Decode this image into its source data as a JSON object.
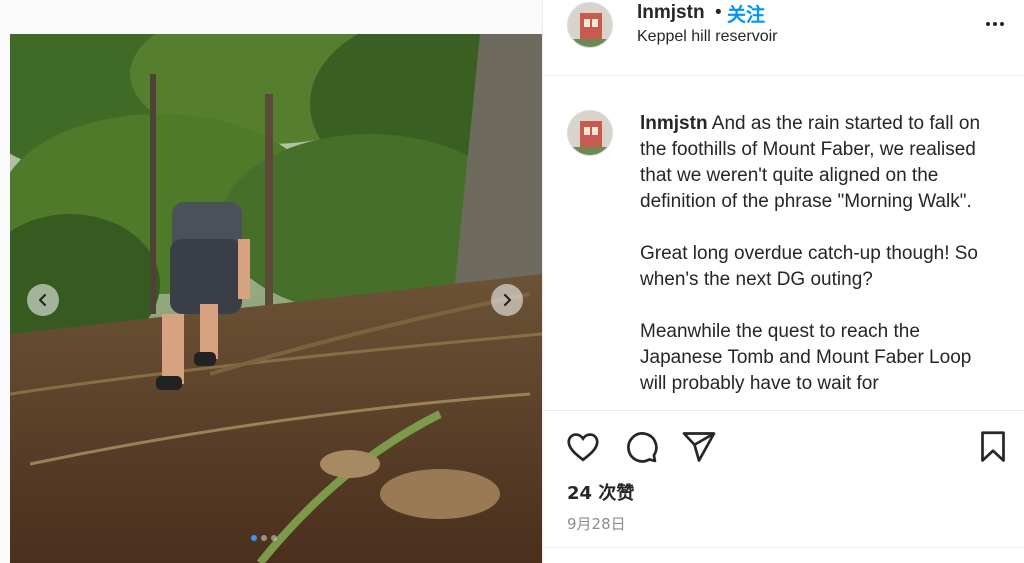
{
  "post": {
    "username": "lnmjstn",
    "separator": "•",
    "follow_label": "关注",
    "location": "Keppel hill reservoir",
    "more_icon": "more-horizontal-icon"
  },
  "caption": {
    "username": "lnmjstn",
    "text": " And as the rain started to fall on the foothills of Mount Faber, we realised that we weren't quite aligned on the definition of the phrase \"Morning Walk\".\n\nGreat long overdue catch-up though! So when's the next DG outing?\n\nMeanwhile the quest to reach the Japanese Tomb and Mount Faber Loop will probably have to wait for"
  },
  "actions": {
    "like_icon": "heart-outline-icon",
    "comment_icon": "comment-bubble-icon",
    "share_icon": "paper-plane-icon",
    "save_icon": "bookmark-outline-icon"
  },
  "stats": {
    "likes": "24 次赞",
    "date": "9月28日"
  },
  "carousel": {
    "prev_icon": "chevron-left-icon",
    "next_icon": "chevron-right-icon",
    "slide_count": 3,
    "active_index": 0
  },
  "colors": {
    "follow_blue": "#0095f6",
    "text": "#262626",
    "muted": "#8e8e8e",
    "border": "#efefef"
  }
}
